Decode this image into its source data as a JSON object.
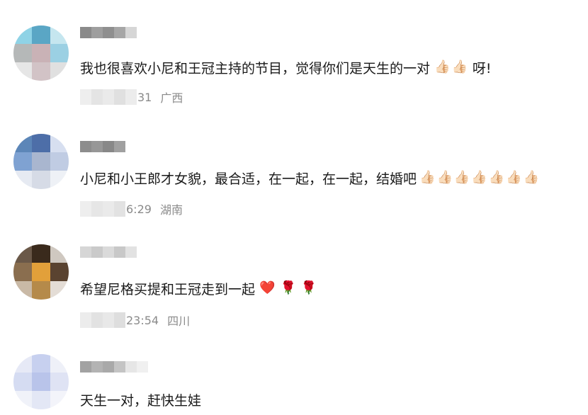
{
  "comments": [
    {
      "text": "我也很喜欢小尼和王冠主持的节目，觉得你们是天生的一对",
      "emojis_after": [
        "👍🏻",
        "👍🏻"
      ],
      "suffix": "呀!",
      "time": "31",
      "location": "广西"
    },
    {
      "text": "小尼和小王郎才女貌，最合适，在一起，在一起，结婚吧",
      "emojis_after": [
        "👍🏻",
        "👍🏻",
        "👍🏻",
        "👍🏻",
        "👍🏻",
        "👍🏻",
        "👍🏻"
      ],
      "suffix": "",
      "time": "6:29",
      "location": "湖南"
    },
    {
      "text": "希望尼格买提和王冠走到一起",
      "emojis_after": [
        "❤️",
        "🌹",
        "🌹"
      ],
      "suffix": "",
      "time": "23:54",
      "location": "四川"
    },
    {
      "text": "天生一对，赶快生娃",
      "emojis_after": [],
      "suffix": "",
      "time": "",
      "location": ""
    }
  ],
  "icons": {
    "thumbs_up": "thumbs-up-icon",
    "heart": "heart-icon",
    "rose": "rose-icon"
  },
  "colors": {
    "text": "#1a1a1a",
    "meta": "#8a8a8a"
  }
}
